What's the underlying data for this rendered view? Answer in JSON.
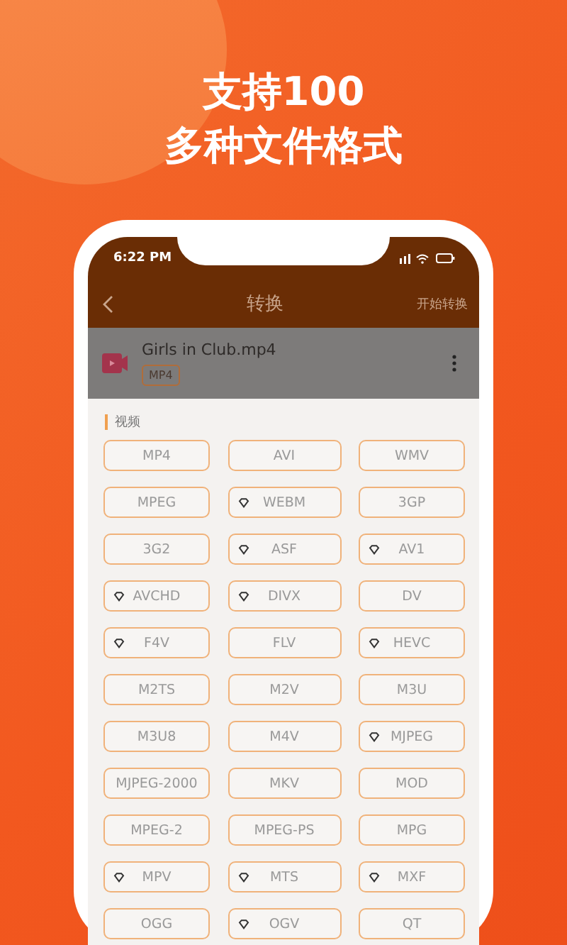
{
  "headline": [
    "支持100",
    "多种文件格式"
  ],
  "status_bar": {
    "time": "6:22 PM"
  },
  "nav": {
    "title": "转换",
    "action": "开始转换"
  },
  "file": {
    "name": "Girls in Club.mp4",
    "tag": "MP4"
  },
  "section": {
    "title": "视频"
  },
  "formats": [
    {
      "label": "MP4",
      "premium": false
    },
    {
      "label": "AVI",
      "premium": false
    },
    {
      "label": "WMV",
      "premium": false
    },
    {
      "label": "MPEG",
      "premium": false
    },
    {
      "label": "WEBM",
      "premium": true
    },
    {
      "label": "3GP",
      "premium": false
    },
    {
      "label": "3G2",
      "premium": false
    },
    {
      "label": "ASF",
      "premium": true
    },
    {
      "label": "AV1",
      "premium": true
    },
    {
      "label": "AVCHD",
      "premium": true
    },
    {
      "label": "DIVX",
      "premium": true
    },
    {
      "label": "DV",
      "premium": false
    },
    {
      "label": "F4V",
      "premium": true
    },
    {
      "label": "FLV",
      "premium": false
    },
    {
      "label": "HEVC",
      "premium": true
    },
    {
      "label": "M2TS",
      "premium": false
    },
    {
      "label": "M2V",
      "premium": false
    },
    {
      "label": "M3U",
      "premium": false
    },
    {
      "label": "M3U8",
      "premium": false
    },
    {
      "label": "M4V",
      "premium": false
    },
    {
      "label": "MJPEG",
      "premium": true
    },
    {
      "label": "MJPEG-2000",
      "premium": false
    },
    {
      "label": "MKV",
      "premium": false
    },
    {
      "label": "MOD",
      "premium": false
    },
    {
      "label": "MPEG-2",
      "premium": false
    },
    {
      "label": "MPEG-PS",
      "premium": false
    },
    {
      "label": "MPG",
      "premium": false
    },
    {
      "label": "MPV",
      "premium": true
    },
    {
      "label": "MTS",
      "premium": true
    },
    {
      "label": "MXF",
      "premium": true
    },
    {
      "label": "OGG",
      "premium": false
    },
    {
      "label": "OGV",
      "premium": true
    },
    {
      "label": "QT",
      "premium": false
    }
  ]
}
